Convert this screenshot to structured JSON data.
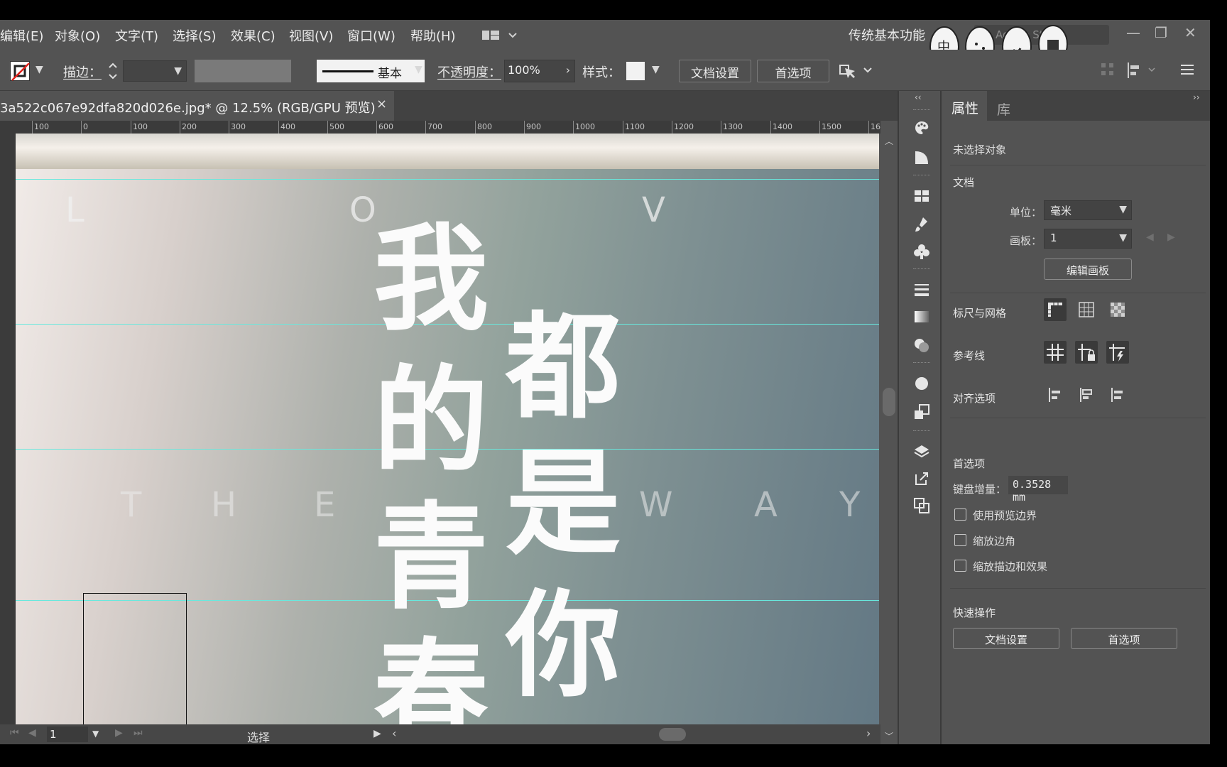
{
  "menu": {
    "items": [
      "编辑(E)",
      "对象(O)",
      "文字(T)",
      "选择(S)",
      "效果(C)",
      "视图(V)",
      "窗口(W)",
      "帮助(H)"
    ],
    "workspace": "传统基本功能",
    "stock_search": "Adobe Stock"
  },
  "control": {
    "stroke_label": "描边：",
    "stroke_style": "基本",
    "opacity_label": "不透明度：",
    "opacity_value": "100%",
    "style_label": "样式：",
    "doc_setup": "文档设置",
    "preferences": "首选项"
  },
  "document": {
    "tab_title": "3a522c067e92dfa820d026e.jpg* @ 12.5% (RGB/GPU 预览)",
    "close": "×"
  },
  "ruler": {
    "labels": [
      "100",
      "0",
      "100",
      "200",
      "300",
      "400",
      "500",
      "600",
      "700",
      "800",
      "900",
      "1000",
      "1100",
      "1200",
      "1300",
      "1400",
      "1500",
      "16"
    ]
  },
  "artwork": {
    "love_letters": [
      "L",
      "O",
      "V"
    ],
    "the_way_letters": [
      "T",
      "H",
      "E",
      "W",
      "A",
      "Y"
    ],
    "chars": [
      "我",
      "的",
      "青",
      "春",
      "都",
      "是",
      "你"
    ]
  },
  "status": {
    "artboard": "1",
    "tool": "选择"
  },
  "panel": {
    "tabs": [
      "属性",
      "库"
    ],
    "no_selection": "未选择对象",
    "document_head": "文档",
    "unit_label": "单位：",
    "unit_value": "毫米",
    "artboard_label": "画板：",
    "artboard_value": "1",
    "edit_artboards": "编辑画板",
    "rulers_grids": "标尺与网格",
    "guides": "参考线",
    "align_options": "对齐选项",
    "preferences_head": "首选项",
    "keyboard_increment_label": "键盘增量：",
    "keyboard_increment_value": "0.3528 mm",
    "cb_preview_bounds": "使用预览边界",
    "cb_scale_corners": "缩放边角",
    "cb_scale_strokes": "缩放描边和效果",
    "quick_actions": "快速操作",
    "qa_doc_setup": "文档设置",
    "qa_preferences": "首选项"
  },
  "colors": {
    "ui_bg": "#535353",
    "ui_dark": "#424242",
    "guide": "#68e8dd",
    "text": "#e6e6e6"
  }
}
